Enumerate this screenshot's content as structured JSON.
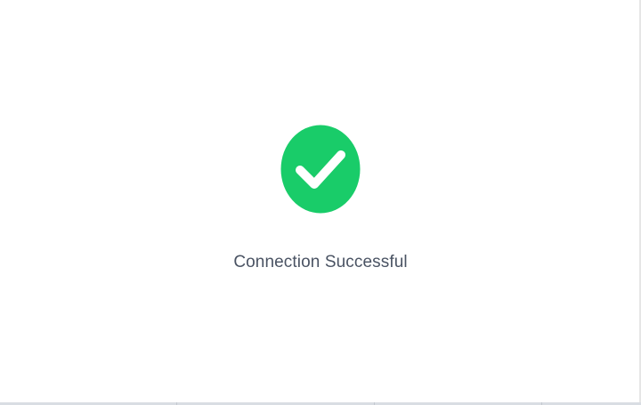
{
  "status": {
    "icon": "check-circle-icon",
    "message": "Connection Successful",
    "accent_color": "#19cc69"
  }
}
